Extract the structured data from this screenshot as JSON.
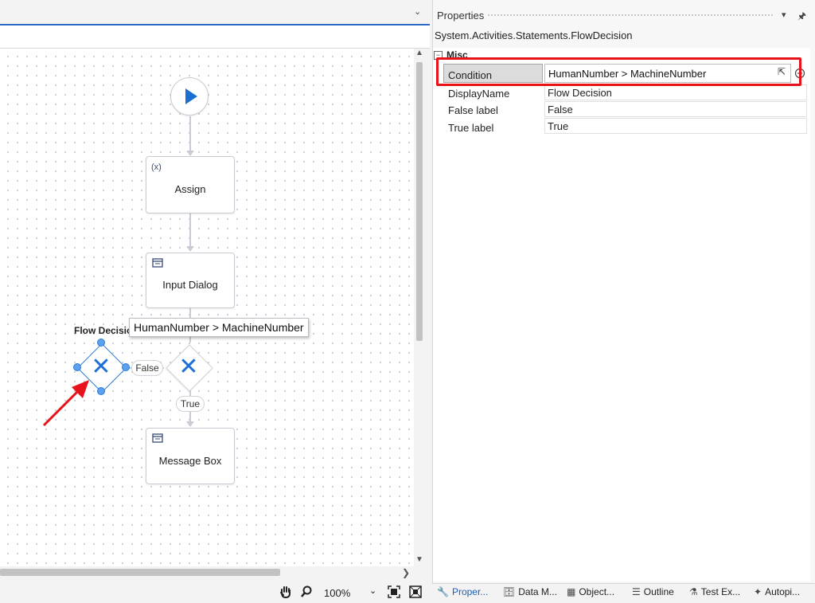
{
  "designer": {
    "nodes": {
      "assign_label": "Assign",
      "assign_icon_text": "(x)",
      "input_dialog_label": "Input Dialog",
      "message_box_label": "Message Box",
      "flow_decision_title": "Flow Decision",
      "false_pill": "False",
      "true_pill": "True",
      "condition_tooltip": "HumanNumber > MachineNumber"
    },
    "toolbar": {
      "zoom_value": "100%"
    }
  },
  "properties": {
    "title": "Properties",
    "object_type": "System.Activities.Statements.FlowDecision",
    "category": "Misc",
    "rows": [
      {
        "name": "Condition",
        "value": "HumanNumber > MachineNumber"
      },
      {
        "name": "DisplayName",
        "value": "Flow Decision"
      },
      {
        "name": "False label",
        "value": "False"
      },
      {
        "name": "True label",
        "value": "True"
      }
    ]
  },
  "bottom_tabs": [
    {
      "label": "Proper...",
      "icon": "wrench-icon"
    },
    {
      "label": "Data M...",
      "icon": "data-manager-icon"
    },
    {
      "label": "Object...",
      "icon": "object-repository-icon"
    },
    {
      "label": "Outline",
      "icon": "outline-icon"
    },
    {
      "label": "Test Ex...",
      "icon": "test-explorer-icon"
    },
    {
      "label": "Autopi...",
      "icon": "sparkle-icon"
    }
  ],
  "colors": {
    "accent": "#1a6fd1",
    "highlight": "#e8121b"
  }
}
